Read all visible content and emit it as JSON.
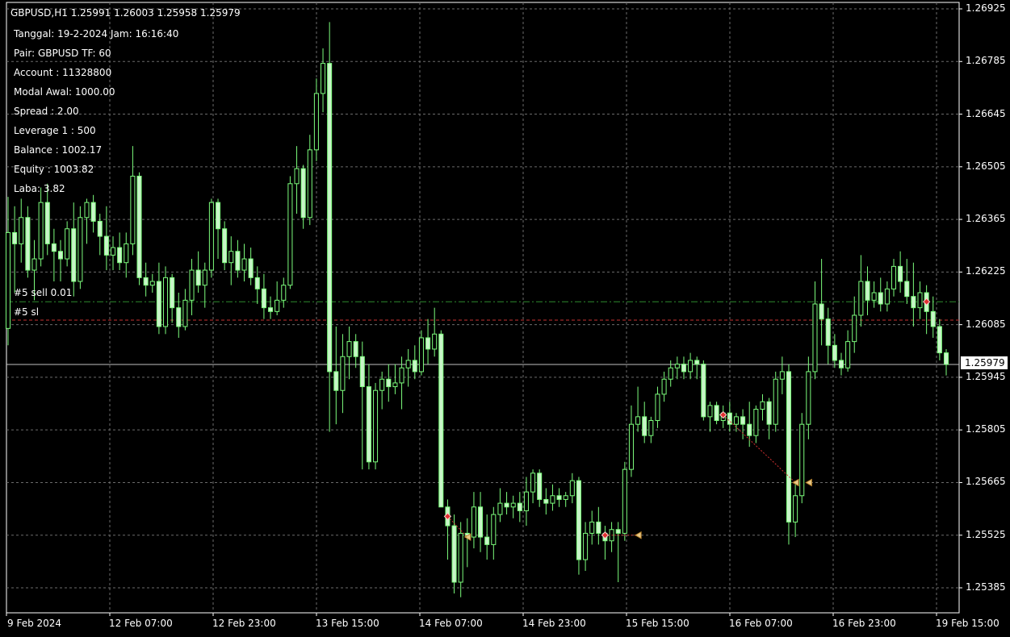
{
  "header": {
    "symbol_line": "GBPUSD,H1  1.25991 1.26003 1.25958 1.25979"
  },
  "info": {
    "lines": [
      "Tanggal: 19-2-2024 Jam: 16:16:40",
      "Pair: GBPUSD TF: 60",
      "Account : 11328800",
      "Modal Awal: 1000.00",
      "Spread : 2.00",
      "Leverage 1 : 500",
      "Balance : 1002.17",
      "Equity : 1003.82",
      "Laba: 3.82"
    ]
  },
  "orders": {
    "sell_label": "#5 sell 0.01",
    "sl_label": "#5 sl",
    "sell_price": 1.26146,
    "sl_price": 1.26097
  },
  "bid": "1.25979",
  "colors": {
    "background": "#000000",
    "grid": "#6b6b6b",
    "candle_bull_fill": "#000000",
    "candle_bear_fill": "#c8f5c8",
    "candle_outline": "#7cfc7c",
    "sell_line": "#2e8b2e",
    "sl_line": "#c83232",
    "bid_line": "#c0c0c0"
  },
  "chart_data": {
    "type": "candlestick",
    "symbol": "GBPUSD",
    "timeframe": "H1",
    "price_ticks": [
      "1.26925",
      "1.26785",
      "1.26645",
      "1.26505",
      "1.26365",
      "1.26225",
      "1.26085",
      "1.25945",
      "1.25805",
      "1.25665",
      "1.25525",
      "1.25385"
    ],
    "time_ticks": [
      "9 Feb 2024",
      "12 Feb 07:00",
      "12 Feb 23:00",
      "13 Feb 15:00",
      "14 Feb 07:00",
      "14 Feb 23:00",
      "15 Feb 15:00",
      "16 Feb 07:00",
      "16 Feb 23:00",
      "19 Feb 15:00"
    ],
    "ylim": [
      1.25355,
      1.26935
    ],
    "grid": true,
    "trade_markers": [
      {
        "type": "sell",
        "index": 67,
        "price": 1.25575
      },
      {
        "type": "close",
        "index": 70,
        "price": 1.2552
      },
      {
        "type": "sell",
        "index": 91,
        "price": 1.25525
      },
      {
        "type": "close",
        "index": 96,
        "price": 1.25525
      },
      {
        "type": "sell",
        "index": 109,
        "price": 1.25845
      },
      {
        "type": "close",
        "index": 120,
        "price": 1.25665
      },
      {
        "type": "close",
        "index": 122,
        "price": 1.25665
      },
      {
        "type": "sell",
        "index": 140,
        "price": 1.26146
      }
    ],
    "ohlc": [
      [
        1.26075,
        1.26425,
        1.2603,
        1.2633
      ],
      [
        1.2633,
        1.264,
        1.2617,
        1.263
      ],
      [
        1.263,
        1.2642,
        1.2625,
        1.2637
      ],
      [
        1.2637,
        1.264,
        1.2621,
        1.2623
      ],
      [
        1.2623,
        1.2631,
        1.2615,
        1.2626
      ],
      [
        1.2626,
        1.2645,
        1.2624,
        1.2641
      ],
      [
        1.2641,
        1.2646,
        1.2627,
        1.263
      ],
      [
        1.263,
        1.2634,
        1.262,
        1.2628
      ],
      [
        1.2628,
        1.2631,
        1.262,
        1.2626
      ],
      [
        1.2626,
        1.2636,
        1.2624,
        1.2634
      ],
      [
        1.2634,
        1.2641,
        1.2616,
        1.262
      ],
      [
        1.262,
        1.264,
        1.2618,
        1.2637
      ],
      [
        1.2637,
        1.2642,
        1.263,
        1.2641
      ],
      [
        1.2641,
        1.2643,
        1.2633,
        1.2636
      ],
      [
        1.2636,
        1.2638,
        1.2627,
        1.2632
      ],
      [
        1.2632,
        1.264,
        1.2623,
        1.2627
      ],
      [
        1.2627,
        1.2632,
        1.2623,
        1.2629
      ],
      [
        1.2629,
        1.2633,
        1.2623,
        1.2625
      ],
      [
        1.2625,
        1.2633,
        1.2621,
        1.263
      ],
      [
        1.263,
        1.2656,
        1.2627,
        1.2648
      ],
      [
        1.2648,
        1.2649,
        1.2619,
        1.2621
      ],
      [
        1.2621,
        1.2625,
        1.2616,
        1.2619
      ],
      [
        1.2619,
        1.2622,
        1.2617,
        1.262
      ],
      [
        1.262,
        1.2625,
        1.2606,
        1.2608
      ],
      [
        1.2608,
        1.2624,
        1.2606,
        1.2621
      ],
      [
        1.2621,
        1.2622,
        1.2609,
        1.2613
      ],
      [
        1.2613,
        1.2617,
        1.2605,
        1.2608
      ],
      [
        1.2608,
        1.2618,
        1.2607,
        1.2615
      ],
      [
        1.2615,
        1.2626,
        1.2611,
        1.2623
      ],
      [
        1.2623,
        1.2628,
        1.2617,
        1.2619
      ],
      [
        1.2619,
        1.2625,
        1.2613,
        1.2623
      ],
      [
        1.2623,
        1.2642,
        1.2621,
        1.2641
      ],
      [
        1.2641,
        1.2642,
        1.2626,
        1.2634
      ],
      [
        1.2634,
        1.2636,
        1.2623,
        1.2625
      ],
      [
        1.2625,
        1.2632,
        1.2619,
        1.2628
      ],
      [
        1.2628,
        1.2631,
        1.2621,
        1.2623
      ],
      [
        1.2623,
        1.263,
        1.262,
        1.2626
      ],
      [
        1.2626,
        1.2629,
        1.2619,
        1.2621
      ],
      [
        1.2621,
        1.2624,
        1.2614,
        1.2618
      ],
      [
        1.2618,
        1.2622,
        1.261,
        1.2613
      ],
      [
        1.2613,
        1.2616,
        1.261,
        1.2612
      ],
      [
        1.2612,
        1.262,
        1.2611,
        1.2615
      ],
      [
        1.2615,
        1.2621,
        1.2613,
        1.2619
      ],
      [
        1.2619,
        1.2648,
        1.2618,
        1.2646
      ],
      [
        1.2646,
        1.2656,
        1.2638,
        1.265
      ],
      [
        1.265,
        1.2651,
        1.2634,
        1.2637
      ],
      [
        1.2637,
        1.2659,
        1.2635,
        1.2655
      ],
      [
        1.2655,
        1.2674,
        1.2652,
        1.267
      ],
      [
        1.267,
        1.2682,
        1.2665,
        1.2678
      ],
      [
        1.2678,
        1.2689,
        1.258,
        1.2596
      ],
      [
        1.2596,
        1.2608,
        1.2582,
        1.2591
      ],
      [
        1.2591,
        1.2606,
        1.2585,
        1.26
      ],
      [
        1.26,
        1.2608,
        1.2594,
        1.2604
      ],
      [
        1.2604,
        1.2606,
        1.2597,
        1.26
      ],
      [
        1.26,
        1.2604,
        1.257,
        1.2592
      ],
      [
        1.2592,
        1.2598,
        1.257,
        1.2572
      ],
      [
        1.2572,
        1.2593,
        1.257,
        1.2591
      ],
      [
        1.2591,
        1.2596,
        1.2586,
        1.2594
      ],
      [
        1.2594,
        1.2598,
        1.2588,
        1.2592
      ],
      [
        1.2592,
        1.2598,
        1.259,
        1.2593
      ],
      [
        1.2593,
        1.26,
        1.2586,
        1.2597
      ],
      [
        1.2597,
        1.2602,
        1.2592,
        1.2599
      ],
      [
        1.2599,
        1.2603,
        1.2594,
        1.2596
      ],
      [
        1.2596,
        1.2607,
        1.2595,
        1.2605
      ],
      [
        1.2605,
        1.261,
        1.2598,
        1.2602
      ],
      [
        1.2602,
        1.2613,
        1.26,
        1.2606
      ],
      [
        1.2606,
        1.2607,
        1.256,
        1.256
      ],
      [
        1.256,
        1.2562,
        1.2546,
        1.2555
      ],
      [
        1.2555,
        1.2558,
        1.2537,
        1.254
      ],
      [
        1.254,
        1.2556,
        1.2536,
        1.2553
      ],
      [
        1.2553,
        1.2557,
        1.2544,
        1.2552
      ],
      [
        1.2552,
        1.2564,
        1.2549,
        1.256
      ],
      [
        1.256,
        1.2564,
        1.2548,
        1.2552
      ],
      [
        1.2552,
        1.2558,
        1.2546,
        1.255
      ],
      [
        1.255,
        1.256,
        1.2546,
        1.2558
      ],
      [
        1.2558,
        1.2565,
        1.2556,
        1.2561
      ],
      [
        1.2561,
        1.2564,
        1.2558,
        1.256
      ],
      [
        1.256,
        1.2563,
        1.2557,
        1.2561
      ],
      [
        1.2561,
        1.2564,
        1.2556,
        1.2559
      ],
      [
        1.2559,
        1.2568,
        1.2555,
        1.2564
      ],
      [
        1.2564,
        1.257,
        1.2561,
        1.2569
      ],
      [
        1.2569,
        1.257,
        1.256,
        1.2562
      ],
      [
        1.2562,
        1.2565,
        1.2558,
        1.2561
      ],
      [
        1.2561,
        1.2566,
        1.2559,
        1.2563
      ],
      [
        1.2563,
        1.2565,
        1.256,
        1.2562
      ],
      [
        1.2562,
        1.2564,
        1.256,
        1.2563
      ],
      [
        1.2563,
        1.2569,
        1.2561,
        1.2567
      ],
      [
        1.2567,
        1.2568,
        1.2542,
        1.2546
      ],
      [
        1.2546,
        1.2556,
        1.2543,
        1.2553
      ],
      [
        1.2553,
        1.2559,
        1.255,
        1.2556
      ],
      [
        1.2556,
        1.256,
        1.255,
        1.2553
      ],
      [
        1.2553,
        1.2555,
        1.2546,
        1.2551
      ],
      [
        1.2551,
        1.2556,
        1.2548,
        1.2554
      ],
      [
        1.2554,
        1.2556,
        1.254,
        1.2553
      ],
      [
        1.2553,
        1.2572,
        1.2551,
        1.257
      ],
      [
        1.257,
        1.2587,
        1.2568,
        1.2582
      ],
      [
        1.2582,
        1.2592,
        1.258,
        1.2584
      ],
      [
        1.2584,
        1.2588,
        1.2577,
        1.2579
      ],
      [
        1.2579,
        1.2584,
        1.2577,
        1.2583
      ],
      [
        1.2583,
        1.2592,
        1.2581,
        1.259
      ],
      [
        1.259,
        1.2596,
        1.2588,
        1.2594
      ],
      [
        1.2594,
        1.2599,
        1.2592,
        1.2597
      ],
      [
        1.2597,
        1.26,
        1.2594,
        1.2598
      ],
      [
        1.2598,
        1.26,
        1.2594,
        1.2596
      ],
      [
        1.2596,
        1.2601,
        1.2594,
        1.2599
      ],
      [
        1.2599,
        1.26,
        1.2594,
        1.2598
      ],
      [
        1.2598,
        1.2599,
        1.2583,
        1.2584
      ],
      [
        1.2584,
        1.2588,
        1.258,
        1.2587
      ],
      [
        1.2587,
        1.2588,
        1.2582,
        1.2583
      ],
      [
        1.2583,
        1.2587,
        1.2581,
        1.2585
      ],
      [
        1.2585,
        1.2588,
        1.258,
        1.2582
      ],
      [
        1.2582,
        1.2585,
        1.258,
        1.2584
      ],
      [
        1.2584,
        1.2586,
        1.2578,
        1.2582
      ],
      [
        1.2582,
        1.2588,
        1.2576,
        1.2579
      ],
      [
        1.2579,
        1.2587,
        1.2577,
        1.2586
      ],
      [
        1.2586,
        1.259,
        1.2583,
        1.2588
      ],
      [
        1.2588,
        1.2589,
        1.2578,
        1.2582
      ],
      [
        1.2582,
        1.2596,
        1.258,
        1.2594
      ],
      [
        1.2594,
        1.26,
        1.259,
        1.2596
      ],
      [
        1.2596,
        1.2598,
        1.255,
        1.2556
      ],
      [
        1.2556,
        1.2566,
        1.2552,
        1.2563
      ],
      [
        1.2563,
        1.2585,
        1.2561,
        1.2582
      ],
      [
        1.2582,
        1.26,
        1.2578,
        1.2596
      ],
      [
        1.2596,
        1.262,
        1.2594,
        1.2614
      ],
      [
        1.2614,
        1.2626,
        1.2603,
        1.261
      ],
      [
        1.261,
        1.2613,
        1.2598,
        1.2603
      ],
      [
        1.2603,
        1.2606,
        1.2597,
        1.2599
      ],
      [
        1.2599,
        1.2601,
        1.2595,
        1.2597
      ],
      [
        1.2597,
        1.2607,
        1.2596,
        1.2604
      ],
      [
        1.2604,
        1.2616,
        1.2601,
        1.2611
      ],
      [
        1.2611,
        1.2627,
        1.2608,
        1.262
      ],
      [
        1.262,
        1.2624,
        1.2611,
        1.2615
      ],
      [
        1.2615,
        1.262,
        1.2613,
        1.2617
      ],
      [
        1.2617,
        1.2621,
        1.2612,
        1.2614
      ],
      [
        1.2614,
        1.262,
        1.2612,
        1.2618
      ],
      [
        1.2618,
        1.2626,
        1.2616,
        1.2624
      ],
      [
        1.2624,
        1.2628,
        1.2617,
        1.262
      ],
      [
        1.262,
        1.2626,
        1.2614,
        1.2616
      ],
      [
        1.2616,
        1.2625,
        1.2608,
        1.2613
      ],
      [
        1.2613,
        1.262,
        1.261,
        1.2617
      ],
      [
        1.2617,
        1.2619,
        1.2606,
        1.2612
      ],
      [
        1.2612,
        1.2616,
        1.2605,
        1.2608
      ],
      [
        1.2608,
        1.261,
        1.2599,
        1.2601
      ],
      [
        1.2601,
        1.2602,
        1.2595,
        1.25979
      ]
    ]
  }
}
